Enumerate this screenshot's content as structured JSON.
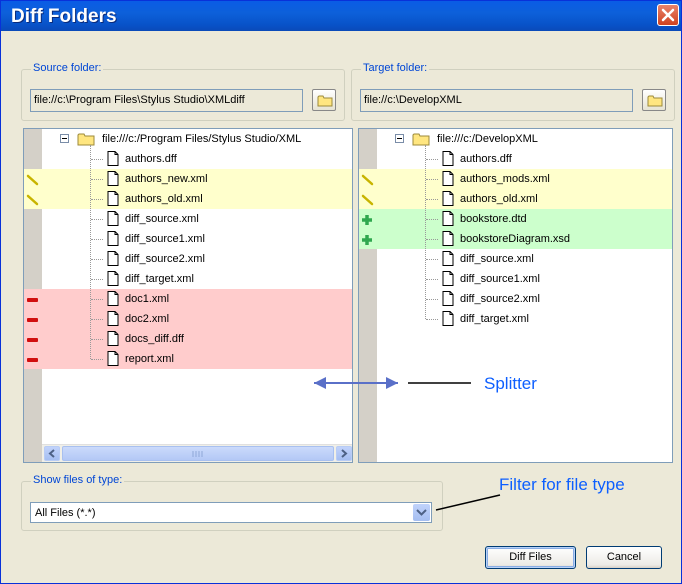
{
  "window": {
    "title": "Diff Folders"
  },
  "source": {
    "label": "Source folder:",
    "path": "file://c:\\Program Files\\Stylus Studio\\XMLdiff",
    "root": "file:///c:/Program Files/Stylus Studio/XML",
    "items": [
      {
        "name": "authors.dff",
        "status": "none"
      },
      {
        "name": "authors_new.xml",
        "status": "changed"
      },
      {
        "name": "authors_old.xml",
        "status": "changed"
      },
      {
        "name": "diff_source.xml",
        "status": "none"
      },
      {
        "name": "diff_source1.xml",
        "status": "none"
      },
      {
        "name": "diff_source2.xml",
        "status": "none"
      },
      {
        "name": "diff_target.xml",
        "status": "none"
      },
      {
        "name": "doc1.xml",
        "status": "removed"
      },
      {
        "name": "doc2.xml",
        "status": "removed"
      },
      {
        "name": "docs_diff.dff",
        "status": "removed"
      },
      {
        "name": "report.xml",
        "status": "removed"
      }
    ]
  },
  "target": {
    "label": "Target folder:",
    "path": "file://c:\\DevelopXML",
    "root": "file:///c:/DevelopXML",
    "items": [
      {
        "name": "authors.dff",
        "status": "none"
      },
      {
        "name": "authors_mods.xml",
        "status": "changed"
      },
      {
        "name": "authors_old.xml",
        "status": "changed"
      },
      {
        "name": "bookstore.dtd",
        "status": "added"
      },
      {
        "name": "bookstoreDiagram.xsd",
        "status": "added"
      },
      {
        "name": "diff_source.xml",
        "status": "none"
      },
      {
        "name": "diff_source1.xml",
        "status": "none"
      },
      {
        "name": "diff_source2.xml",
        "status": "none"
      },
      {
        "name": "diff_target.xml",
        "status": "none"
      }
    ]
  },
  "filter": {
    "label": "Show files of type:",
    "selected": "All Files (*.*)"
  },
  "buttons": {
    "diff": "Diff Files",
    "cancel": "Cancel"
  },
  "annotations": {
    "splitter": "Splitter",
    "filter": "Filter for file type"
  },
  "colors": {
    "changed_row": "#FFFFCC",
    "added_row": "#CCFFCC",
    "removed_row": "#FFCCCC",
    "title_bar": "#0A5CE6",
    "annotation": "#0D5FFF"
  }
}
